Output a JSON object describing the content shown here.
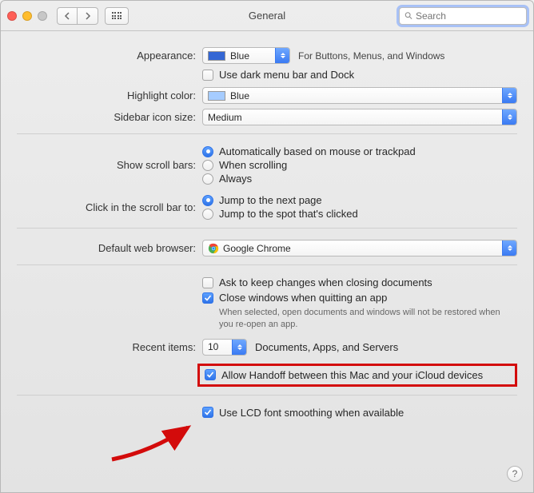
{
  "window": {
    "title": "General"
  },
  "search": {
    "placeholder": "Search"
  },
  "labels": {
    "appearance": "Appearance:",
    "highlight": "Highlight color:",
    "sidebar_size": "Sidebar icon size:",
    "scroll_bars": "Show scroll bars:",
    "scroll_click": "Click in the scroll bar to:",
    "default_browser": "Default web browser:",
    "recent_items": "Recent items:"
  },
  "appearance": {
    "value": "Blue",
    "swatch": "#3567d4",
    "hint": "For Buttons, Menus, and Windows",
    "dark_menu_label": "Use dark menu bar and Dock",
    "dark_menu_checked": false
  },
  "highlight": {
    "value": "Blue",
    "swatch": "#a6ccff"
  },
  "sidebar_size": {
    "value": "Medium"
  },
  "scroll_bars": {
    "options": [
      "Automatically based on mouse or trackpad",
      "When scrolling",
      "Always"
    ],
    "selected": 0
  },
  "scroll_click": {
    "options": [
      "Jump to the next page",
      "Jump to the spot that's clicked"
    ],
    "selected": 0
  },
  "default_browser": {
    "value": "Google Chrome"
  },
  "documents": {
    "ask_label": "Ask to keep changes when closing documents",
    "ask_checked": false,
    "close_label": "Close windows when quitting an app",
    "close_checked": true,
    "close_sub": "When selected, open documents and windows will not be restored when you re-open an app."
  },
  "recent": {
    "value": "10",
    "suffix": "Documents, Apps, and Servers"
  },
  "handoff": {
    "label": "Allow Handoff between this Mac and your iCloud devices",
    "checked": true
  },
  "lcd": {
    "label": "Use LCD font smoothing when available",
    "checked": true
  },
  "help": {
    "label": "?"
  }
}
